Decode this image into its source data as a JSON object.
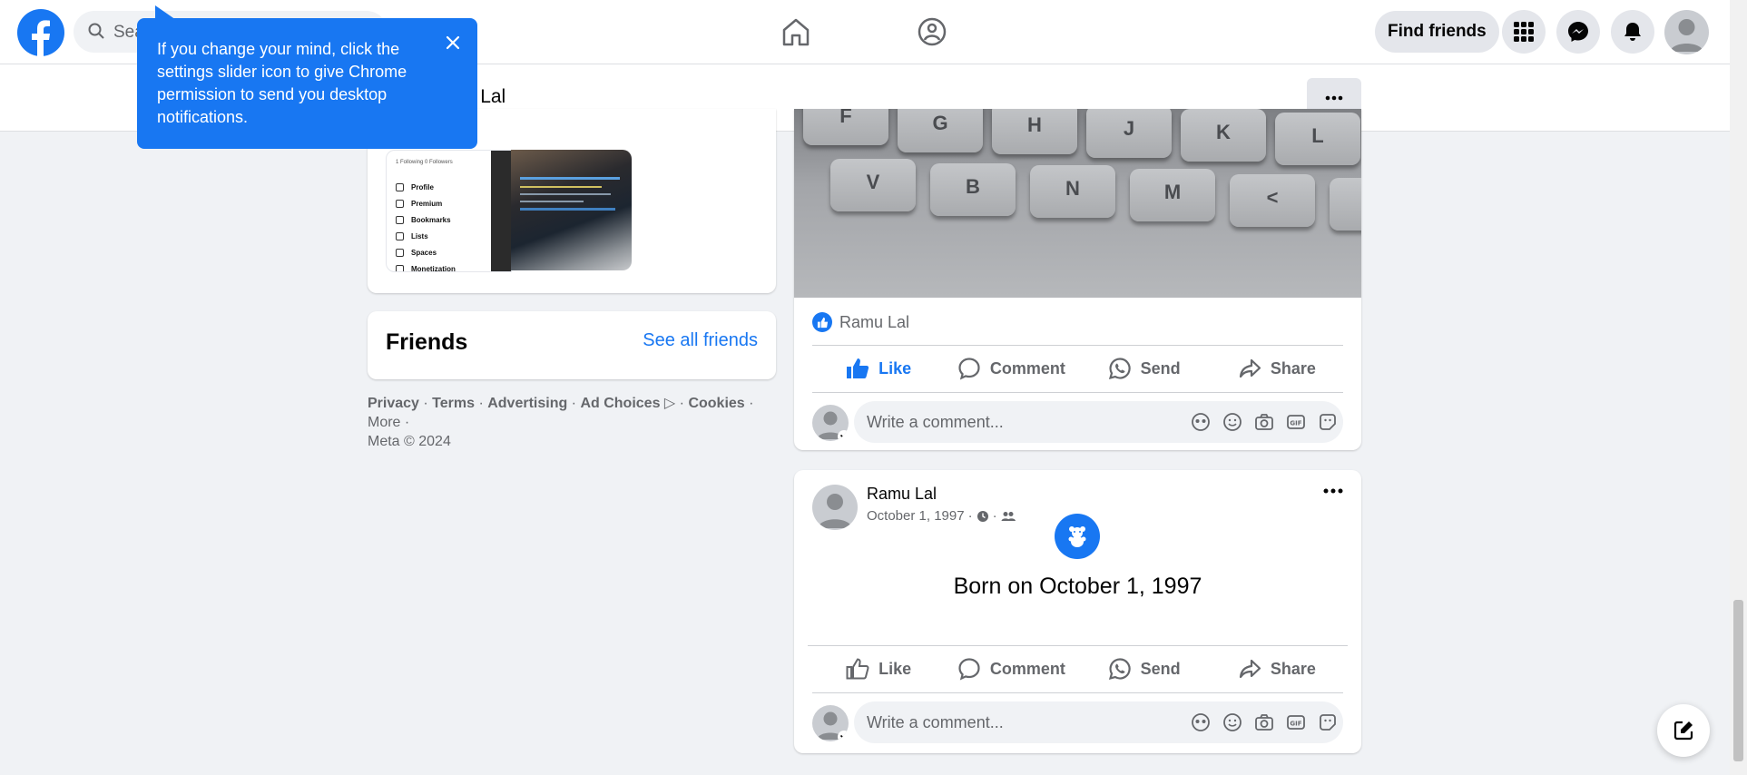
{
  "header": {
    "search_placeholder": "Search Facebook",
    "search_visible": "Sea",
    "find_friends": "Find friends"
  },
  "tooltip": {
    "text": "If you change your mind, click the settings slider icon to give Chrome permission to send you desktop notifications."
  },
  "profile_bar": {
    "name_visible": "nu Lal"
  },
  "photos": {
    "thumb_menu": [
      "Profile",
      "Premium",
      "Bookmarks",
      "Lists",
      "Spaces",
      "Monetization"
    ],
    "thumb_header": "1 Following  0 Followers"
  },
  "friends": {
    "title": "Friends",
    "see_all": "See all friends"
  },
  "footer": {
    "privacy": "Privacy",
    "terms": "Terms",
    "advertising": "Advertising",
    "ad_choices": "Ad Choices",
    "cookies": "Cookies",
    "more": "More",
    "copyright": "Meta © 2024"
  },
  "post1": {
    "keys_row1": [
      "F",
      "G",
      "H",
      "J",
      "K",
      "L"
    ],
    "keys_row2": [
      "V",
      "B",
      "N",
      "M",
      "<",
      ">"
    ],
    "reacted_by": "Ramu Lal",
    "actions": {
      "like": "Like",
      "comment": "Comment",
      "send": "Send",
      "share": "Share"
    },
    "comment_placeholder": "Write a comment..."
  },
  "post2": {
    "author": "Ramu Lal",
    "date": "October 1, 1997",
    "life_event": "Born on October 1, 1997",
    "actions": {
      "like": "Like",
      "comment": "Comment",
      "send": "Send",
      "share": "Share"
    },
    "comment_placeholder": "Write a comment..."
  },
  "colors": {
    "brand": "#1877f2",
    "background": "#f0f2f5",
    "text_secondary": "#65676b"
  }
}
